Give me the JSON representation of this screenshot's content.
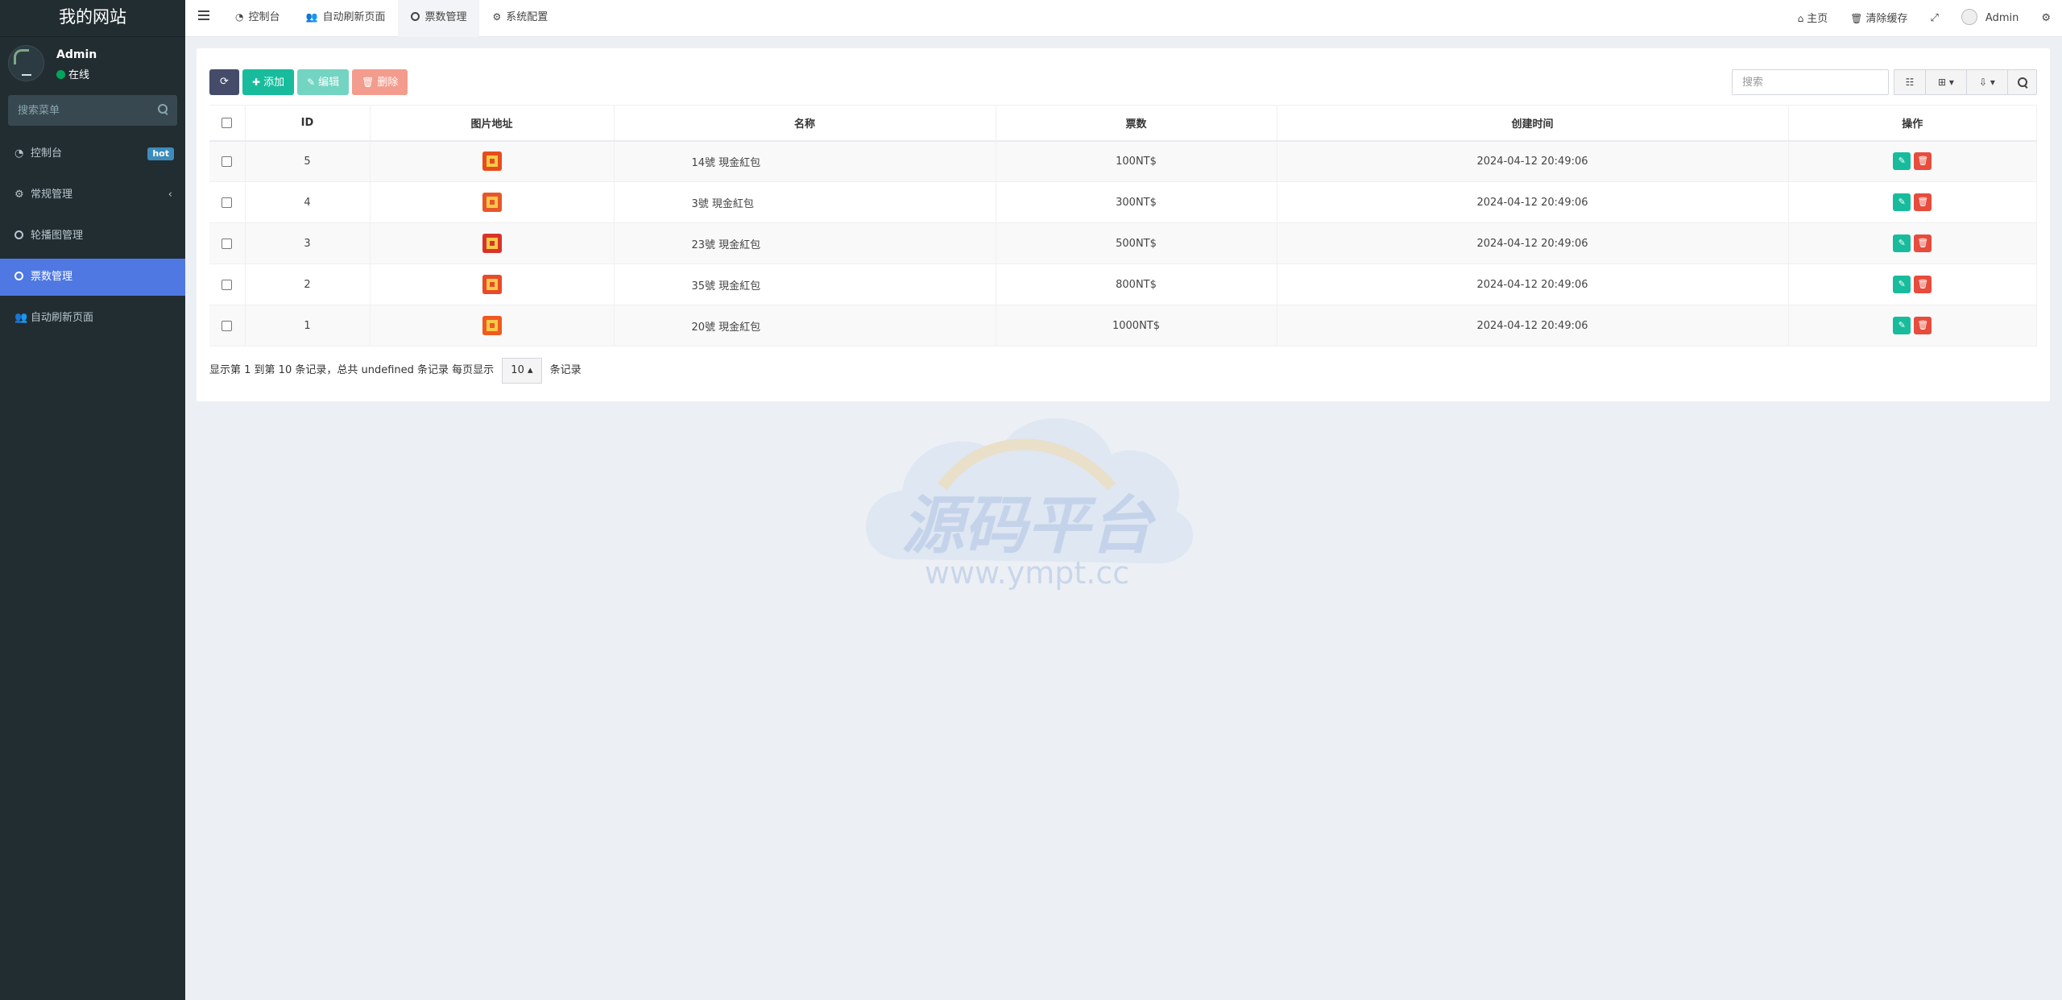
{
  "sidebar": {
    "logo": "我的网站",
    "user": {
      "name": "Admin",
      "status": "在线"
    },
    "search_placeholder": "搜索菜单",
    "menu": [
      {
        "label": "控制台",
        "icon": "dashboard-icon",
        "badge": "hot"
      },
      {
        "label": "常规管理",
        "icon": "cogs-icon",
        "chevron": "‹"
      },
      {
        "label": "轮播图管理",
        "icon": "circle-icon"
      },
      {
        "label": "票数管理",
        "icon": "circle-icon",
        "active": true
      },
      {
        "label": "自动刷新页面",
        "icon": "users-icon"
      }
    ]
  },
  "header": {
    "tabs": [
      {
        "label": "控制台",
        "icon": "dashboard-icon"
      },
      {
        "label": "自动刷新页面",
        "icon": "users-icon"
      },
      {
        "label": "票数管理",
        "icon": "circle-icon",
        "active": true
      },
      {
        "label": "系统配置",
        "icon": "gear-icon"
      }
    ],
    "right": {
      "home": "主页",
      "clear_cache": "清除缓存",
      "user": "Admin"
    }
  },
  "toolbar": {
    "add": "添加",
    "edit": "编辑",
    "delete": "删除",
    "search_placeholder": "搜索"
  },
  "table": {
    "columns": [
      "ID",
      "图片地址",
      "名称",
      "票数",
      "创建时间",
      "操作"
    ],
    "rows": [
      {
        "id": "5",
        "name": "14號 現金紅包",
        "votes": "100NT$",
        "created": "2024-04-12 20:49:06",
        "thumb_color": "#e74c1c"
      },
      {
        "id": "4",
        "name": "3號 現金紅包",
        "votes": "300NT$",
        "created": "2024-04-12 20:49:06",
        "thumb_color": "#e8562a"
      },
      {
        "id": "3",
        "name": "23號 現金紅包",
        "votes": "500NT$",
        "created": "2024-04-12 20:49:06",
        "thumb_color": "#d8342a"
      },
      {
        "id": "2",
        "name": "35號 現金紅包",
        "votes": "800NT$",
        "created": "2024-04-12 20:49:06",
        "thumb_color": "#e84a2a"
      },
      {
        "id": "1",
        "name": "20號 現金紅包",
        "votes": "1000NT$",
        "created": "2024-04-12 20:49:06",
        "thumb_color": "#f05a20"
      }
    ]
  },
  "pagination": {
    "info": "显示第 1 到第 10 条记录，总共 undefined 条记录 每页显示",
    "page_size": "10",
    "suffix": "条记录"
  },
  "watermark": {
    "title": "源码平台",
    "url": "www.ympt.cc"
  },
  "colors": {
    "sidebar_bg": "#222d32",
    "active_menu": "#4f78e3",
    "success": "#18bc9c",
    "danger": "#e74c3c"
  }
}
